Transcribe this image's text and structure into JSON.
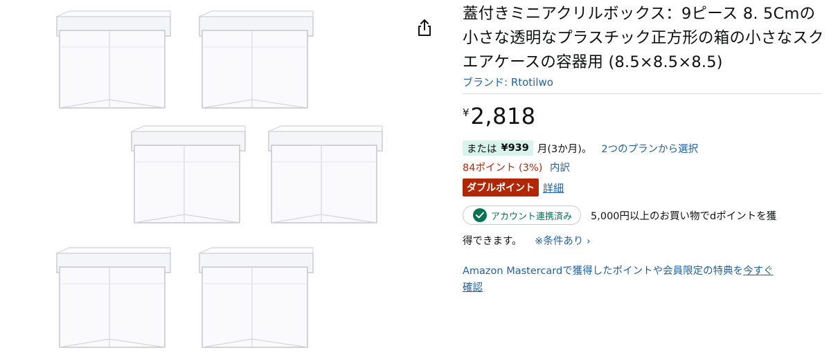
{
  "product": {
    "title": "蓋付きミニアクリルボックス：9ピース 8. 5Cmの小さな透明なプラスチック正方形の箱の小さなスクエアケースの容器用 (8.5×8.5×8.5)",
    "brand": "ブランド: Rtotilwo",
    "price_symbol": "¥",
    "price": "2,818"
  },
  "installment": {
    "prefix": "または",
    "monthly": "¥939",
    "suffix": "月(3か月)。",
    "link": "2つのプランから選択"
  },
  "points": {
    "text": "84ポイント (3%)",
    "link": "内訳"
  },
  "double_point": {
    "badge": "ダブルポイント",
    "link": "詳細"
  },
  "dpoint": {
    "linked_label": "アカウント連携済み",
    "desc_line1": "5,000円以上のお買い物でdポイントを獲",
    "desc_line2": "得できます。",
    "condition_link": "※条件あり ›"
  },
  "mastercard": {
    "text": "Amazon Mastercardで獲得したポイントや会員限定の特典を",
    "link_a": "今すぐ",
    "link_b": "確認"
  },
  "icons": {
    "share": "share-icon",
    "check": "check-icon"
  },
  "colors": {
    "link": "#2162a1",
    "points": "#b12704",
    "badge_bg": "#b12704",
    "plan_bg": "#d8f3ec",
    "linked_green": "#007452"
  }
}
